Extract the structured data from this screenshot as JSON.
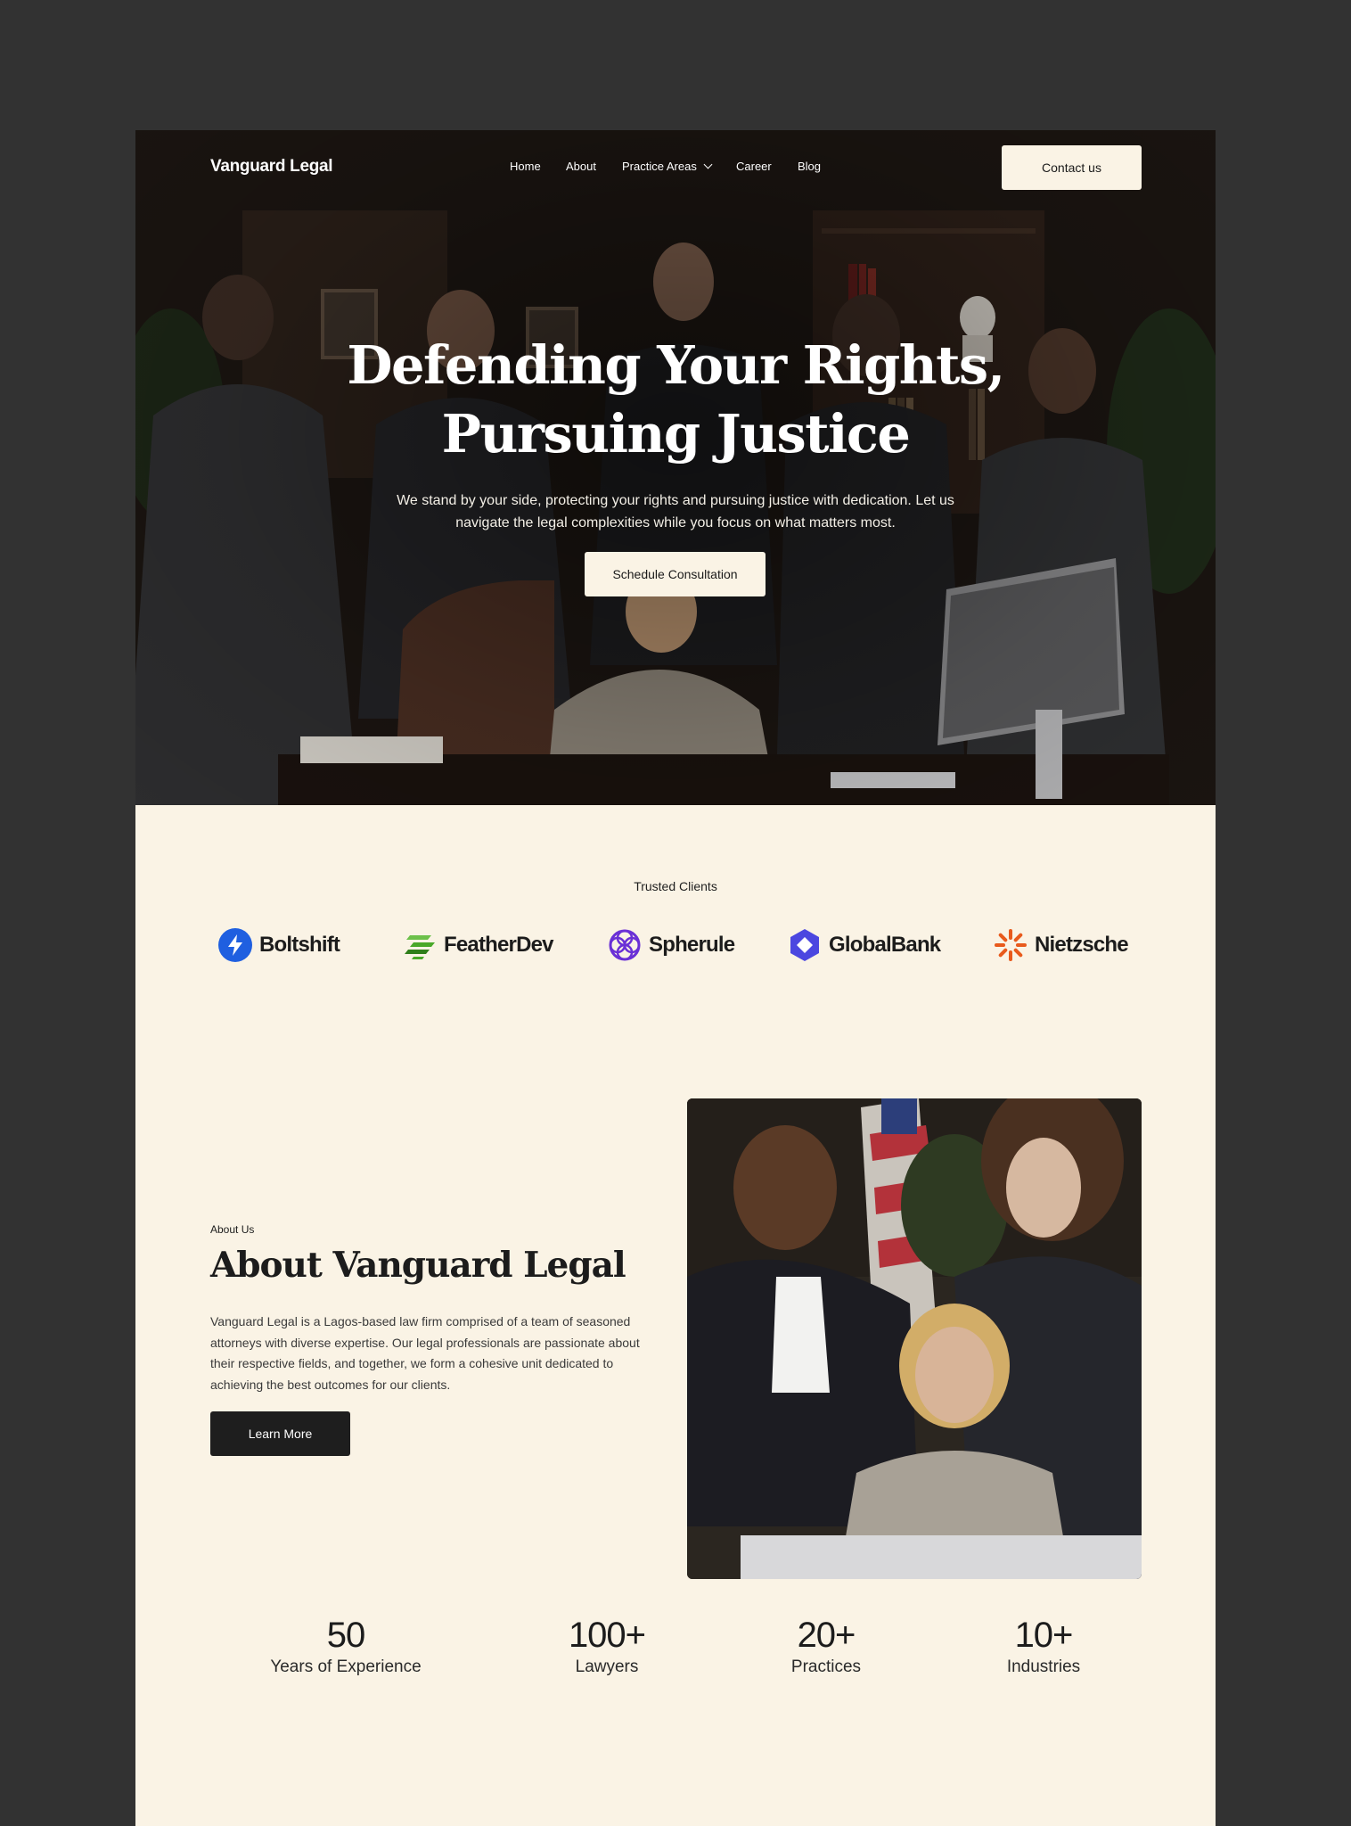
{
  "nav": {
    "brand": "Vanguard Legal",
    "links": [
      "Home",
      "About",
      "Practice Areas",
      "Career",
      "Blog"
    ],
    "contact_label": "Contact us"
  },
  "hero": {
    "title_line1": "Defending Your Rights,",
    "title_line2": "Pursuing Justice",
    "subtitle_line1": "We stand by your side, protecting your rights and pursuing justice with dedication. Let us",
    "subtitle_line2": "navigate the legal complexities while you focus on what matters most.",
    "cta_label": "Schedule Consultation"
  },
  "trusted": {
    "label": "Trusted Clients",
    "clients": [
      {
        "name": "Boltshift",
        "icon": "bolt-icon",
        "color": "#1f5fe0"
      },
      {
        "name": "FeatherDev",
        "icon": "feather-icon",
        "color": "#49a829"
      },
      {
        "name": "Spherule",
        "icon": "sphere-icon",
        "color": "#6a30d6"
      },
      {
        "name": "GlobalBank",
        "icon": "hexagon-icon",
        "color": "#4b47e0"
      },
      {
        "name": "Nietzsche",
        "icon": "sunburst-icon",
        "color": "#e85a1c"
      }
    ]
  },
  "about": {
    "eyebrow": "About Us",
    "title": "About Vanguard Legal",
    "text_lines": [
      "Vanguard Legal is a Lagos-based law firm comprised of a team of seasoned",
      "attorneys with diverse expertise. Our legal professionals are passionate about",
      "their respective fields, and together, we form a cohesive unit dedicated to",
      "achieving the best outcomes for our clients."
    ],
    "cta_label": "Learn More"
  },
  "stats": [
    {
      "value": "50",
      "label": "Years of Experience"
    },
    {
      "value": "100+",
      "label": "Lawyers"
    },
    {
      "value": "20+",
      "label": "Practices"
    },
    {
      "value": "10+",
      "label": "Industries"
    }
  ],
  "colors": {
    "background": "#323232",
    "cream": "#faf3e5",
    "dark": "#1e1e1e"
  }
}
